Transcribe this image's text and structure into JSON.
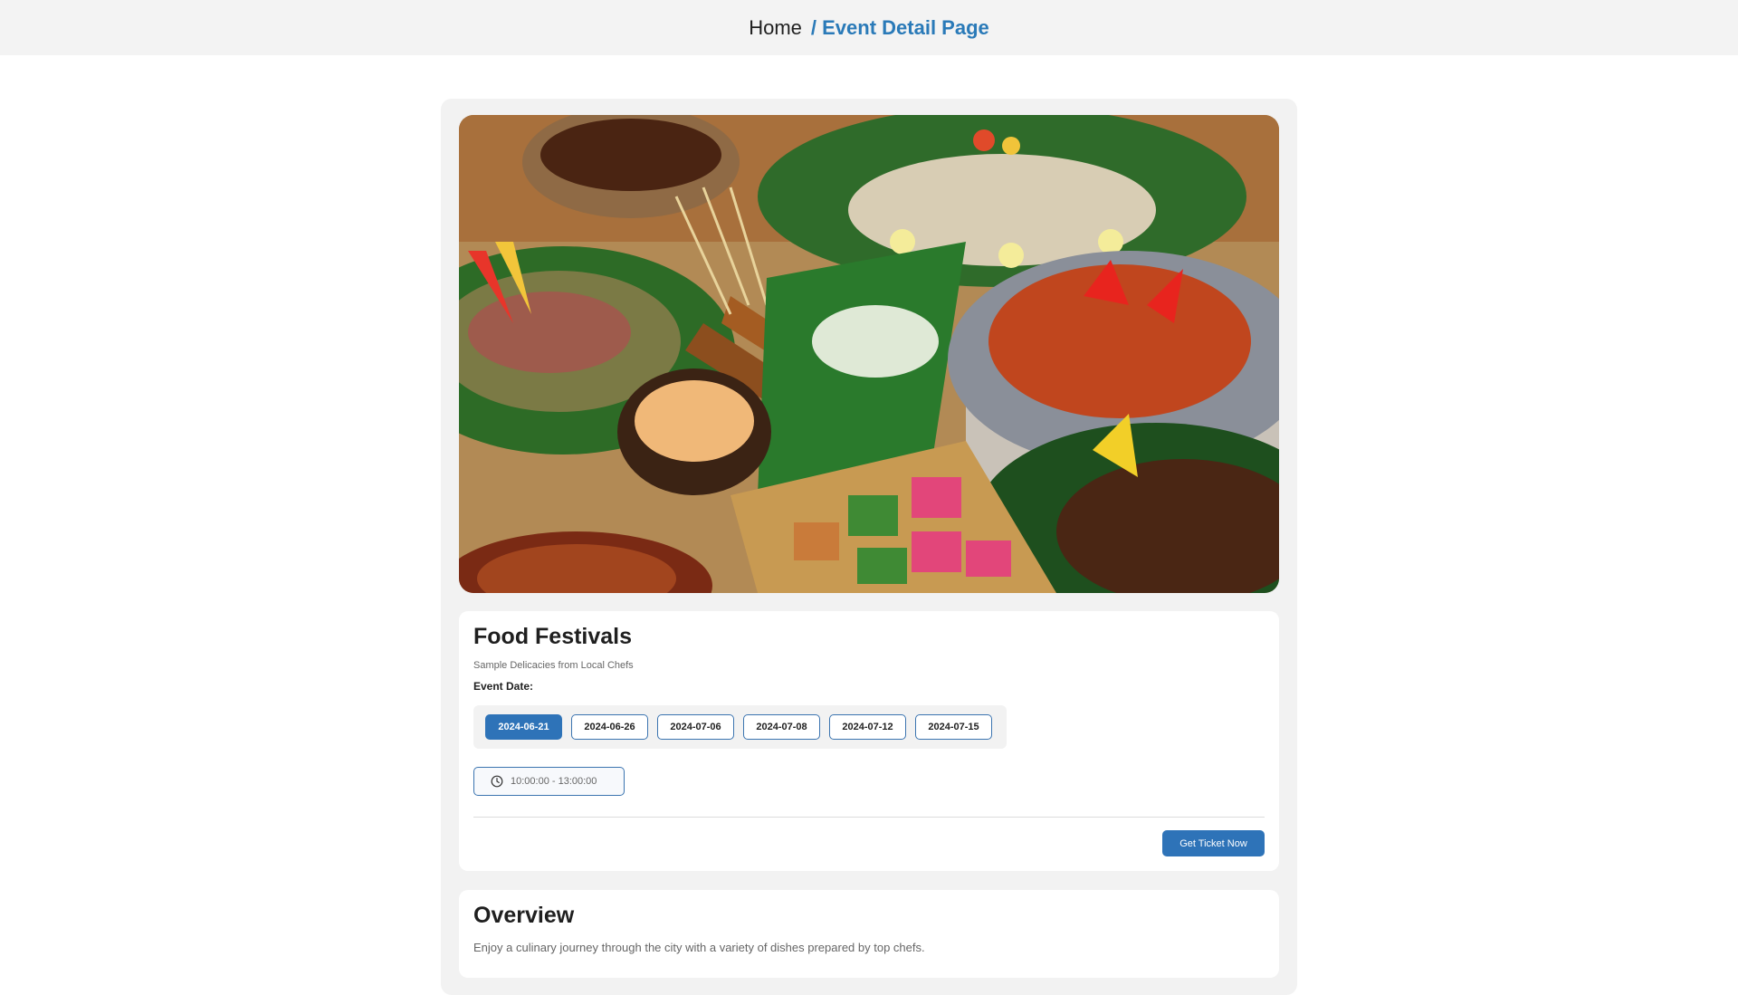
{
  "breadcrumb": {
    "home": "Home",
    "current": "/ Event Detail Page"
  },
  "event": {
    "title": "Food Festivals",
    "subtitle": "Sample Delicacies from Local Chefs",
    "date_label": "Event Date:",
    "dates": [
      "2024-06-21",
      "2024-06-26",
      "2024-07-06",
      "2024-07-08",
      "2024-07-12",
      "2024-07-15"
    ],
    "selected_date": "2024-06-21",
    "time": "10:00:00 - 13:00:00",
    "ticket_button": "Get Ticket Now"
  },
  "overview": {
    "title": "Overview",
    "text": "Enjoy a culinary journey through the city with a variety of dishes prepared by top chefs."
  },
  "colors": {
    "accent": "#2e73b8",
    "breadcrumb_active": "#2a7ab8",
    "panel_bg": "#f2f2f2",
    "topbar_bg": "#f3f3f3"
  },
  "icons": {
    "time": "clock-icon"
  }
}
